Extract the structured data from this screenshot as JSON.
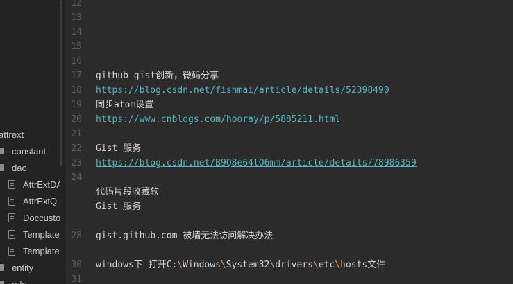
{
  "sidebar": {
    "items": [
      {
        "label": "attrext",
        "icon": "none"
      },
      {
        "label": "constant",
        "icon": "folder-icon"
      },
      {
        "label": "dao",
        "icon": "folder-icon"
      },
      {
        "label": "AttrExtDAO",
        "icon": "file-icon"
      },
      {
        "label": "AttrExtQ",
        "icon": "file-icon"
      },
      {
        "label": "Doccusto",
        "icon": "file-icon"
      },
      {
        "label": "Template",
        "icon": "file-icon"
      },
      {
        "label": "Template",
        "icon": "file-icon"
      },
      {
        "label": "entity",
        "icon": "folder-icon"
      },
      {
        "label": "rule",
        "icon": "folder-icon"
      }
    ]
  },
  "editor": {
    "lines": [
      {
        "num": "12",
        "text": ""
      },
      {
        "num": "13",
        "text": ""
      },
      {
        "num": "14",
        "text": ""
      },
      {
        "num": "15",
        "text": ""
      },
      {
        "num": "16",
        "text": ""
      },
      {
        "num": "17",
        "text": "github gist创新，微码分享"
      },
      {
        "num": "18",
        "text": "https://blog.csdn.net/fishmai/article/details/52398490"
      },
      {
        "num": "19",
        "text": "同步atom设置"
      },
      {
        "num": "20",
        "text": "https://www.cnblogs.com/hooray/p/5885211.html"
      },
      {
        "num": "21",
        "text": ""
      },
      {
        "num": "22",
        "text": "Gist 服务"
      },
      {
        "num": "23",
        "text": "https://blog.csdn.net/B9Q8e64lO6mm/article/details/78986359"
      },
      {
        "num": "24",
        "text": ""
      },
      {
        "num": "",
        "text": "代码片段收藏软"
      },
      {
        "num": "",
        "text": "Gist 服务"
      },
      {
        "num": "",
        "text": ""
      },
      {
        "num": "28",
        "text": "gist.github.com 被墙无法访问解决办法"
      },
      {
        "num": "",
        "text": ""
      },
      {
        "num": "30",
        "text_prefix": "windows下 打开C:",
        "path_parts": [
          "\\",
          "Windows",
          "\\",
          "System32",
          "\\",
          "drivers",
          "\\",
          "etc",
          "\\",
          "h",
          "osts文件"
        ]
      },
      {
        "num": "31",
        "text": ""
      }
    ]
  },
  "colors": {
    "background": "#2b2b2b",
    "sidebar": "#232323",
    "link": "#56b6c2",
    "text": "#d4d4d4",
    "line_number": "#5f5f5f",
    "escape": "#d19a66"
  }
}
